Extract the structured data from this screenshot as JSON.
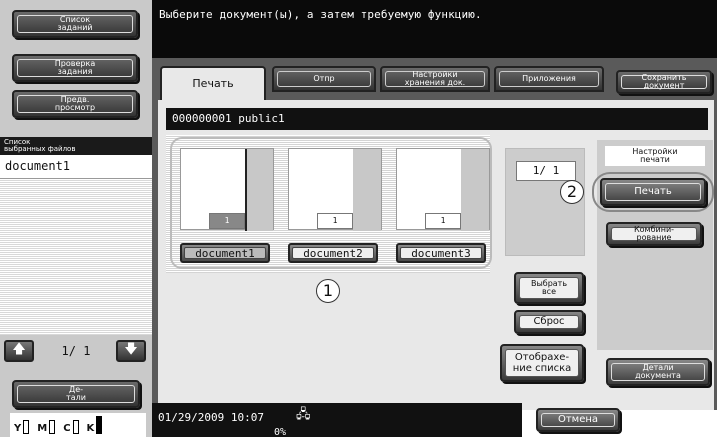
{
  "sidebar": {
    "job_list": "Список\nзаданий",
    "check_job": "Проверка\nзадания",
    "preview": "Предв.\nпросмотр",
    "selected_files_header": "Список\nвыбранных файлов",
    "selected_files": [
      "document1"
    ],
    "page": "1/  1",
    "details": "Де-\nтали",
    "toner": [
      {
        "label": "Y"
      },
      {
        "label": "M"
      },
      {
        "label": "C"
      },
      {
        "label": "K"
      }
    ]
  },
  "header": {
    "message": "Выберите документ(ы), а затем требуемую функцию."
  },
  "tabs": [
    {
      "label": "Печать",
      "active": true
    },
    {
      "label": "Отпр",
      "active": false
    },
    {
      "label": "Настройки\nхранения док.",
      "active": false
    },
    {
      "label": "Приложения",
      "active": false
    }
  ],
  "save_document": "Сохранить\nдокумент",
  "path": "000000001   public1",
  "documents": [
    {
      "name": "document1",
      "page": "1",
      "selected": true
    },
    {
      "name": "document2",
      "page": "1",
      "selected": false
    },
    {
      "name": "document3",
      "page": "1",
      "selected": false
    }
  ],
  "callouts": {
    "one": "1",
    "two": "2"
  },
  "page_counter": "1/  1",
  "buttons": {
    "select_all": "Выбрать\nвсе",
    "reset": "Сброс",
    "show_list": "Отобрахе-\nние списка",
    "print_settings": "Настройки\nпечати",
    "print": "Печать",
    "combine": "Комбини-\nрование",
    "doc_details": "Детали\nдокумента",
    "cancel": "Отмена"
  },
  "status": {
    "datetime": "01/29/2009   10:07",
    "percent": "0%"
  }
}
